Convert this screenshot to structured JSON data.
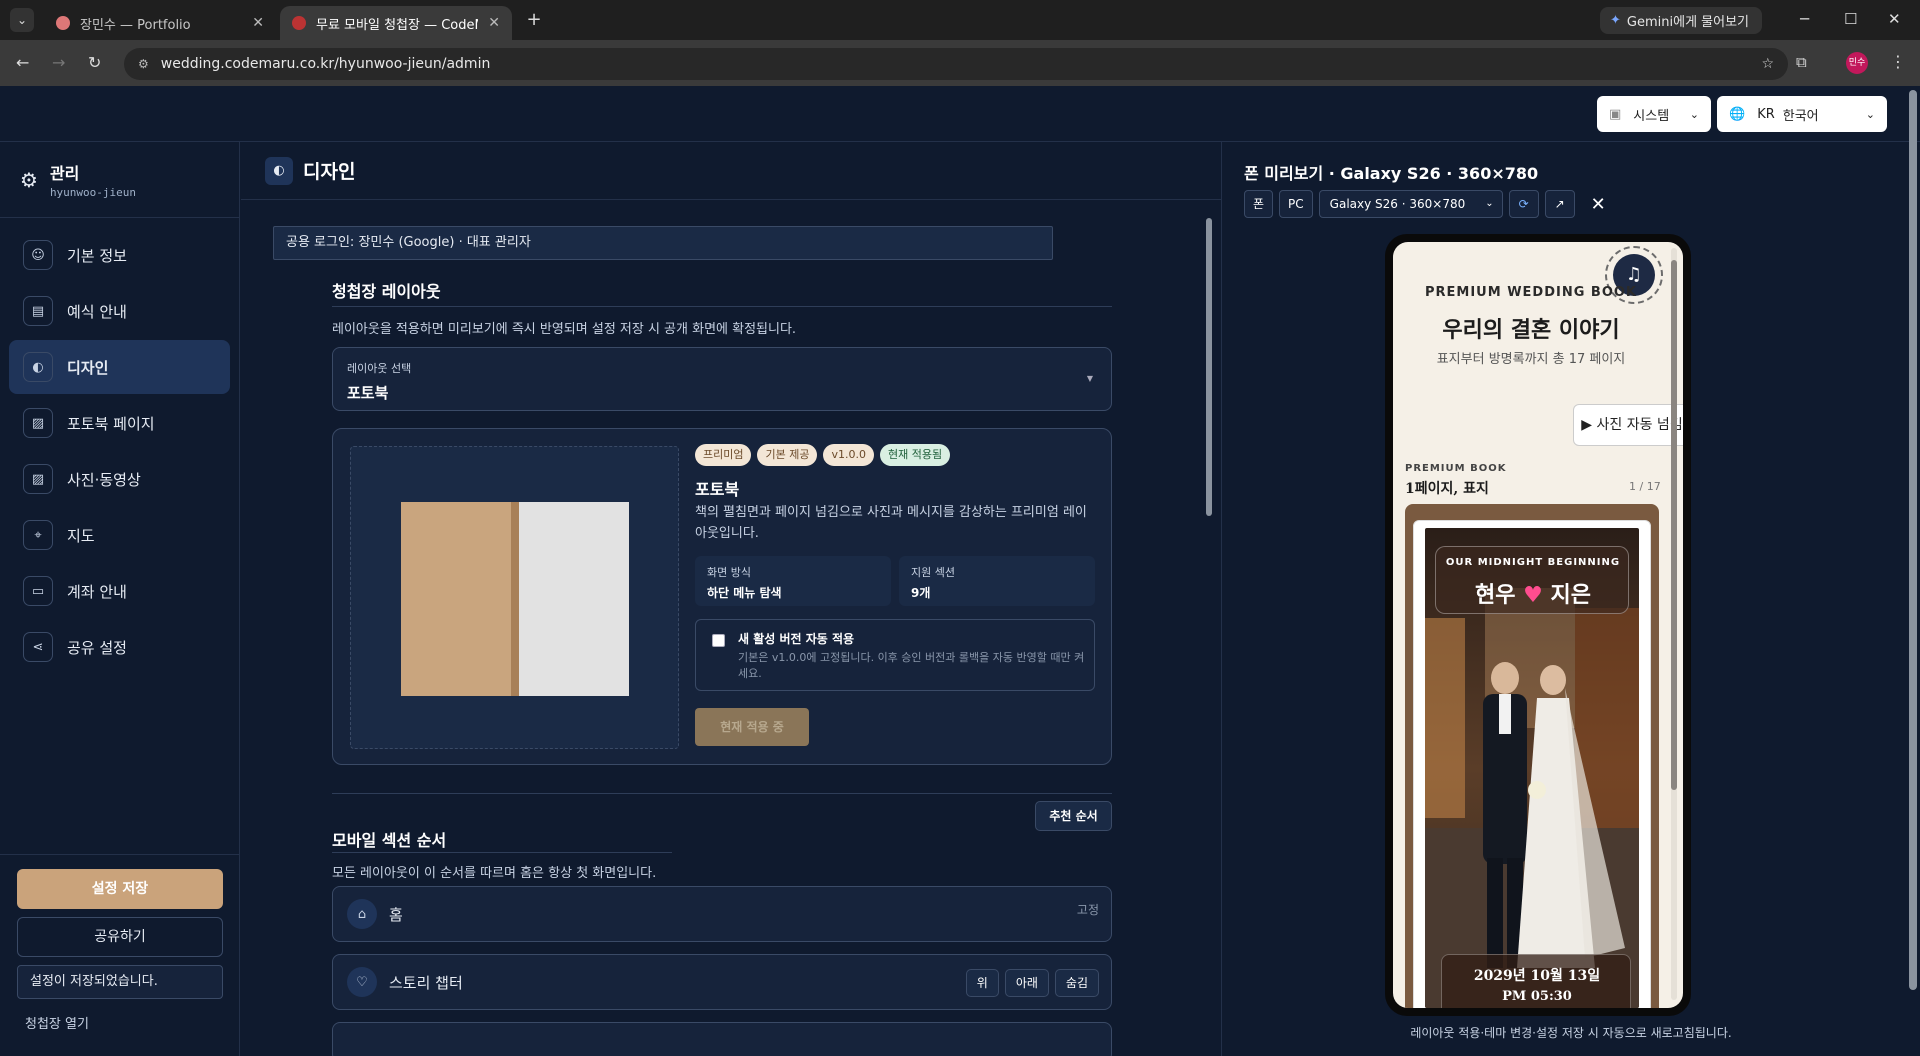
{
  "browser": {
    "tabs": [
      {
        "title": "장민수 — Portfolio"
      },
      {
        "title": "무료 모바일 청첩장 — CodeMaru"
      }
    ],
    "gemini_label": "Gemini에게 물어보기",
    "url": "wedding.codemaru.co.kr/hyunwoo-jieun/admin",
    "profile_initials": "민수"
  },
  "topbar": {
    "theme_label": "시스템",
    "lang_code": "KR",
    "lang_label": "한국어"
  },
  "sidebar": {
    "title": "관리",
    "slug": "hyunwoo-jieun",
    "items": [
      {
        "label": "기본 정보",
        "icon": "person-icon"
      },
      {
        "label": "예식 안내",
        "icon": "document-icon"
      },
      {
        "label": "디자인",
        "icon": "palette-icon"
      },
      {
        "label": "포토북 페이지",
        "icon": "image-icon"
      },
      {
        "label": "사진·동영상",
        "icon": "image-icon"
      },
      {
        "label": "지도",
        "icon": "location-pin-icon"
      },
      {
        "label": "계좌 안내",
        "icon": "card-icon"
      },
      {
        "label": "공유 설정",
        "icon": "share-icon"
      }
    ],
    "active_index": 2,
    "save_button": "설정 저장",
    "share_button": "공유하기",
    "save_status": "설정이 저장되었습니다.",
    "open_link": "청첩장 열기"
  },
  "main": {
    "header_title": "디자인",
    "login_info": "공용 로그인: 장민수 (Google) · 대표 관리자",
    "layout_section": {
      "title": "청첩장 레이아웃",
      "desc": "레이아웃을 적용하면 미리보기에 즉시 반영되며 설정 저장 시 공개 화면에 확정됩니다.",
      "select_label": "레이아웃 선택",
      "select_value": "포토북"
    },
    "card": {
      "badges": [
        "프리미엄",
        "기본 제공",
        "v1.0.0",
        "현재 적용됨"
      ],
      "title": "포토북",
      "desc": "책의 펼침면과 페이지 넘김으로 사진과 메시지를 감상하는 프리미엄 레이아웃입니다.",
      "info": [
        {
          "key": "화면 방식",
          "value": "하단 메뉴 탐색"
        },
        {
          "key": "지원 섹션",
          "value": "9개"
        }
      ],
      "auto_title": "새 활성 버전 자동 적용",
      "auto_desc": "기본은 v1.0.0에 고정됩니다. 이후 승인 버전과 롤백을 자동 반영할 때만 켜세요.",
      "apply_button": "현재 적용 중"
    },
    "order_section": {
      "title": "모바일 섹션 순서",
      "desc": "모든 레이아웃이 이 순서를 따르며 홈은 항상 첫 화면입니다.",
      "recommend_button": "추천 순서",
      "rows": [
        {
          "label": "홈",
          "tag": "고정"
        },
        {
          "label": "스토리 챕터",
          "up": "위",
          "down": "아래",
          "hide": "숨김"
        }
      ]
    }
  },
  "preview": {
    "title": "폰 미리보기 · Galaxy S26 · 360×780",
    "btn_phone": "폰",
    "btn_pc": "PC",
    "device_select": "Galaxy S26 · 360×780",
    "note": "레이아웃 적용·테마 변경·설정 저장 시 자동으로 새로고침됩니다.",
    "phone": {
      "kicker": "PREMIUM WEDDING BOOK",
      "title": "우리의 결혼 이야기",
      "subtitle": "표지부터 방명록까지 총 17 페이지",
      "autoplay": "▶ 사진 자동 넘김",
      "book_kicker": "PREMIUM BOOK",
      "page_label": "1페이지, 표지",
      "page_num": "1 / 17",
      "cover_kicker": "OUR MIDNIGHT BEGINNING",
      "groom": "현우",
      "bride": "지은",
      "date": "2029년 10월 13일",
      "time": "PM 05:30"
    }
  }
}
